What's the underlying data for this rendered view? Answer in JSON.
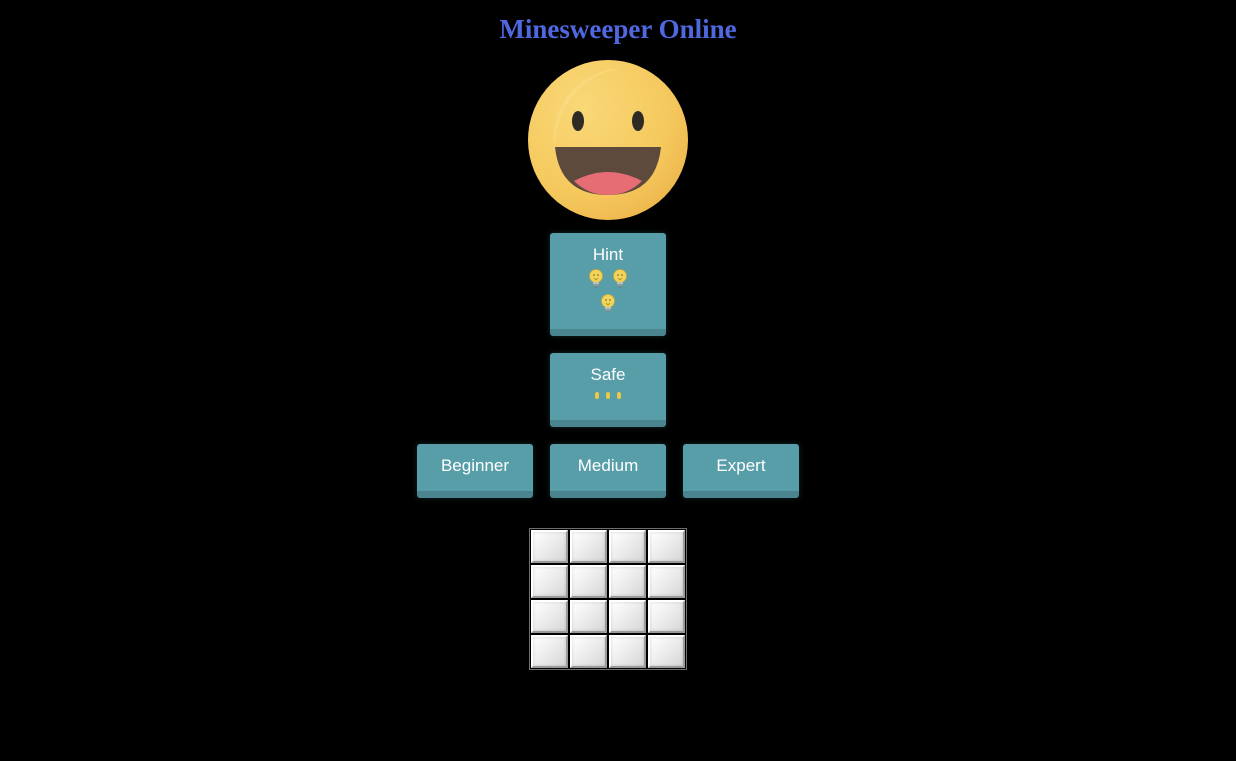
{
  "title": "Minesweeper Online",
  "smiley": {
    "state": "happy",
    "icon": "smiley-face-icon"
  },
  "hint_button": {
    "label": "Hint",
    "remaining": 3,
    "icon": "lightbulb-icon"
  },
  "safe_button": {
    "label": "Safe",
    "remaining": 3,
    "icon": "spark-icon"
  },
  "difficulty_buttons": [
    {
      "label": "Beginner"
    },
    {
      "label": "Medium"
    },
    {
      "label": "Expert"
    }
  ],
  "board": {
    "rows": 4,
    "cols": 4,
    "cells": [
      [
        "hidden",
        "hidden",
        "hidden",
        "hidden"
      ],
      [
        "hidden",
        "hidden",
        "hidden",
        "hidden"
      ],
      [
        "hidden",
        "hidden",
        "hidden",
        "hidden"
      ],
      [
        "hidden",
        "hidden",
        "hidden",
        "hidden"
      ]
    ]
  },
  "colors": {
    "background": "#000000",
    "title": "#4f68e0",
    "button": "#579ea9",
    "button_shadow": "#4a848e",
    "smiley": "#f5c95e"
  }
}
